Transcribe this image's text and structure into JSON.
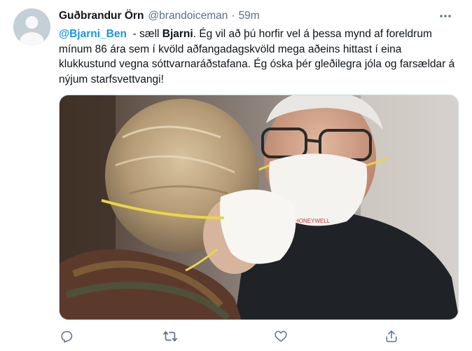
{
  "tweet": {
    "display_name": "Guðbrandur Örn",
    "handle": "@brandoiceman",
    "separator": "·",
    "time": "59m",
    "text": {
      "mention": "@Bjarni_Ben",
      "part1": "  - sæll ",
      "bold_name": "Bjarni",
      "part2": ". Ég vil að þú horfir vel á þessa mynd af foreldrum mínum 86 ára sem í kvöld aðfangadagskvöld mega aðeins hittast í eina klukkustund vegna sóttvarnaráðstafana. Ég óska þér gleðilegra jóla og farsældar á nýjum starfsvettvangi!"
    },
    "media": {
      "mask_print": "HONEYWELL"
    },
    "actions": {
      "reply_icon": "reply-icon",
      "retweet_icon": "retweet-icon",
      "like_icon": "heart-icon",
      "share_icon": "share-icon"
    }
  },
  "colors": {
    "link": "#1b95e0",
    "secondary_text": "#5b7083",
    "icon": "#5b7083"
  }
}
